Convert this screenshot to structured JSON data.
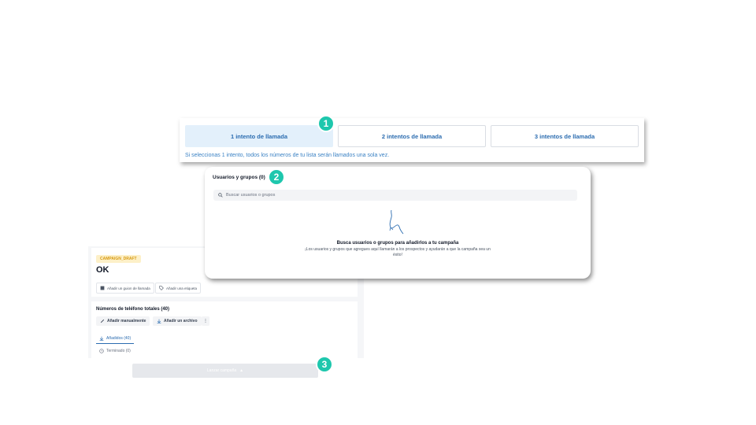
{
  "attempts": {
    "options": [
      "1 intento de llamada",
      "2 intentos de llamada",
      "3 intentos de llamada"
    ],
    "selected_index": 0,
    "help_text": "Si seleccionas 1 intento, todos los números de tu lista serán llamados una sola vez."
  },
  "users": {
    "title": "Usuarios y grupos (0)",
    "search_placeholder": "Buscar usuarios o grupos",
    "empty_title": "Busca usuarios o grupos para añadirlos a tu campaña",
    "empty_description": "¡Los usuarios y grupos que agregues aquí llamarán a los prospectos y ayudarán a que la campaña sea un éxito!"
  },
  "campaign": {
    "status_badge": "CAMPAIGN_DRAFT",
    "name": "OK",
    "add_script": "Añadir un guion de llamada",
    "add_tag": "Añadir una etiqueta",
    "numbers_title": "Números de teléfono totales (40)",
    "add_manual": "Añadir manualmente",
    "add_file": "Añadir un archivo",
    "more": "⋮",
    "tab_added": "Añadidos (40)",
    "status_terminated": "Terminado (0)",
    "launch_label": "Lanzar campaña"
  },
  "steps": [
    "1",
    "2",
    "3"
  ],
  "colors": {
    "accent_blue": "#2b6cb0",
    "selected_bg": "#e3f0fb",
    "step_badge": "#1ec7ad",
    "draft_badge_bg": "#fdf0c8",
    "draft_badge_text": "#d79a12"
  },
  "icons": [
    "search-icon",
    "hand-drawn-arrow-icon",
    "script-icon",
    "tag-icon",
    "pencil-icon",
    "download-icon",
    "clock-icon",
    "rocket-icon"
  ]
}
